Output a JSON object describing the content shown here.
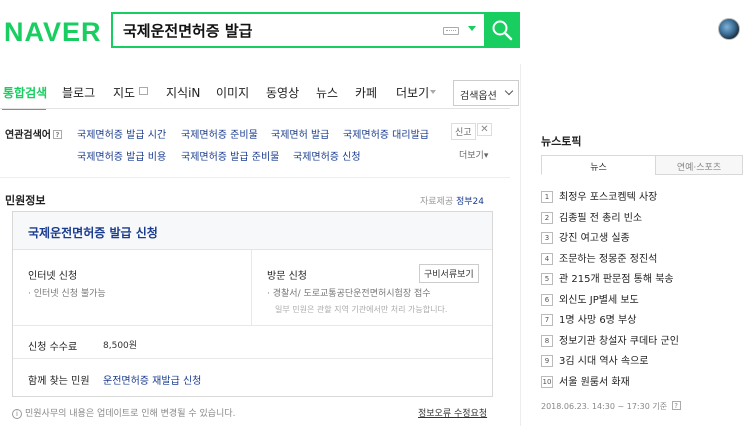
{
  "header": {
    "logo": "NAVER",
    "query": "국제운전면허증 발급"
  },
  "tabs": [
    {
      "label": "통합검색"
    },
    {
      "label": "블로그"
    },
    {
      "label": "지도"
    },
    {
      "label": "지식iN"
    },
    {
      "label": "이미지"
    },
    {
      "label": "동영상"
    },
    {
      "label": "뉴스"
    },
    {
      "label": "카페"
    },
    {
      "label": "더보기"
    }
  ],
  "search_options": "검색옵션",
  "related": {
    "label": "연관검색어",
    "items": [
      "국제면허증 발급 시간",
      "국제면허증 준비물",
      "국제면허 발급",
      "국제면허증 대리발급",
      "국제면허증 발급 비용",
      "국제면허증 발급 준비물",
      "국제면허증 신청"
    ],
    "report": "신고",
    "more": "더보기"
  },
  "civil": {
    "title": "민원정보",
    "source_prefix": "자료제공",
    "source": "정부24",
    "card_title": "국제운전면허증 발급 신청",
    "online_label": "인터넷 신청",
    "online_value": "인터넷 신청 불가능",
    "visit_label": "방문 신청",
    "docs_button": "구비서류보기",
    "visit_value": "경찰서/ 도로교통공단운전면허시험장 접수",
    "visit_note": "일부 민원은 관할 지역 기관에서만 처리 가능합니다.",
    "fee_label": "신청 수수료",
    "fee_value": "8,500원",
    "also_label": "함께 찾는 민원",
    "also_link": "운전면허증 재발급 신청",
    "notice": "민원사무의 내용은 업데이트로 인해 변경될 수 있습니다.",
    "error_link": "정보오류 수정요청"
  },
  "news": {
    "title": "뉴스토픽",
    "tabs": [
      "뉴스",
      "연예·스포츠"
    ],
    "items": [
      {
        "num": "1",
        "text": "최정우 포스코켐텍 사장"
      },
      {
        "num": "2",
        "text": "김종필 전 총리 빈소"
      },
      {
        "num": "3",
        "text": "강진 여고생 실종"
      },
      {
        "num": "4",
        "text": "조문하는 정몽준 정진석"
      },
      {
        "num": "5",
        "text": "관 215개 판문점 통해 북송"
      },
      {
        "num": "6",
        "text": "외신도 JP별세 보도"
      },
      {
        "num": "7",
        "text": "1명 사망 6명 부상"
      },
      {
        "num": "8",
        "text": "정보기관 창설자 쿠데타 군인"
      },
      {
        "num": "9",
        "text": "3김 시대 역사 속으로"
      },
      {
        "num": "10",
        "text": "서울 원룸서 화재"
      }
    ],
    "timestamp": "2018.06.23. 14:30 ~ 17:30 기준"
  },
  "colors": {
    "brand": "#19ce60",
    "link": "#1a3c8f"
  }
}
